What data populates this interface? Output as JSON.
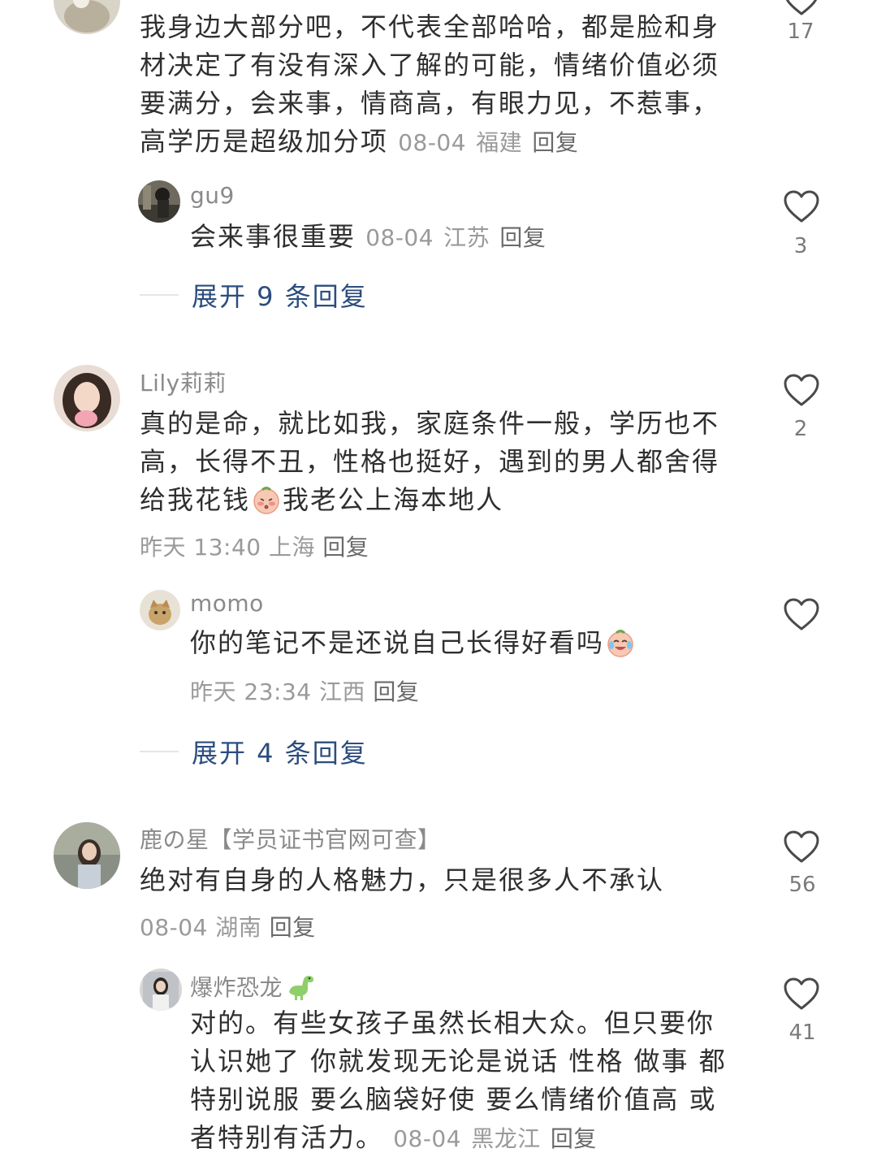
{
  "comments": [
    {
      "text": "我身边大部分吧，不代表全部哈哈，都是脸和身材决定了有没有深入了解的可能，情绪价值必须要满分，会来事，情商高，有眼力见，不惹事，高学历是超级加分项",
      "date": "08-04",
      "location": "福建",
      "reply_label": "回复",
      "likes": "17",
      "replies": [
        {
          "username": "gu9",
          "text": "会来事很重要",
          "date": "08-04",
          "location": "江苏",
          "reply_label": "回复",
          "likes": "3"
        }
      ],
      "expand_label": "展开 9 条回复"
    },
    {
      "username": "Lily莉莉",
      "text_part1": "真的是命，就比如我，家庭条件一般，学历也不高，长得不丑，性格也挺好，遇到的男人都舍得给我花钱",
      "emoji": "shy-emoji",
      "text_part2": "我老公上海本地人",
      "date": "昨天 13:40",
      "location": "上海",
      "reply_label": "回复",
      "likes": "2",
      "replies": [
        {
          "username": "momo",
          "text": "你的笔记不是还说自己长得好看吗",
          "emoji": "laugh-cry-emoji",
          "date": "昨天 23:34",
          "location": "江西",
          "reply_label": "回复",
          "likes": ""
        }
      ],
      "expand_label": "展开 4 条回复"
    },
    {
      "username": "鹿の星【学员证书官网可查】",
      "text": "绝对有自身的人格魅力，只是很多人不承认",
      "date": "08-04",
      "location": "湖南",
      "reply_label": "回复",
      "likes": "56",
      "replies": [
        {
          "username": "爆炸恐龙",
          "username_icon": "dinosaur-icon",
          "text": "对的。有些女孩子虽然长相大众。但只要你认识她了 你就发现无论是说话 性格 做事 都特别说服 要么脑袋好使 要么情绪价值高 或者特别有活力。",
          "date": "08-04",
          "location": "黑龙江",
          "reply_label": "回复",
          "likes": "41"
        }
      ]
    }
  ],
  "colors": {
    "link": "#2b4d7e",
    "meta": "#9a9a9a",
    "text": "#2f2f2f"
  }
}
